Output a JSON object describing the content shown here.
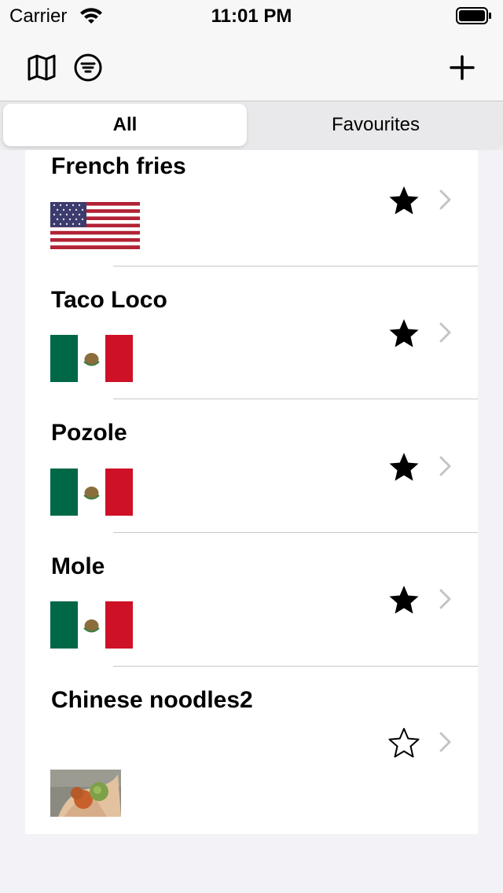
{
  "status_bar": {
    "carrier": "Carrier",
    "time": "11:01 PM"
  },
  "nav": {
    "left_icons": [
      "map-icon",
      "filter-icon"
    ],
    "right_icon": "plus-icon"
  },
  "segments": [
    {
      "label": "All",
      "selected": true
    },
    {
      "label": "Favourites",
      "selected": false
    }
  ],
  "rows": [
    {
      "title": "French fries",
      "image": "flag-usa",
      "favorite": true
    },
    {
      "title": "Taco Loco",
      "image": "flag-mexico",
      "favorite": true
    },
    {
      "title": "Pozole",
      "image": "flag-mexico",
      "favorite": true
    },
    {
      "title": "Mole",
      "image": "flag-mexico",
      "favorite": true
    },
    {
      "title": "Chinese noodles2",
      "image": "photo-hand-food",
      "favorite": false
    }
  ],
  "colors": {
    "accent": "#000000",
    "separator": "#c8c7cc",
    "background": "#f2f2f7"
  }
}
